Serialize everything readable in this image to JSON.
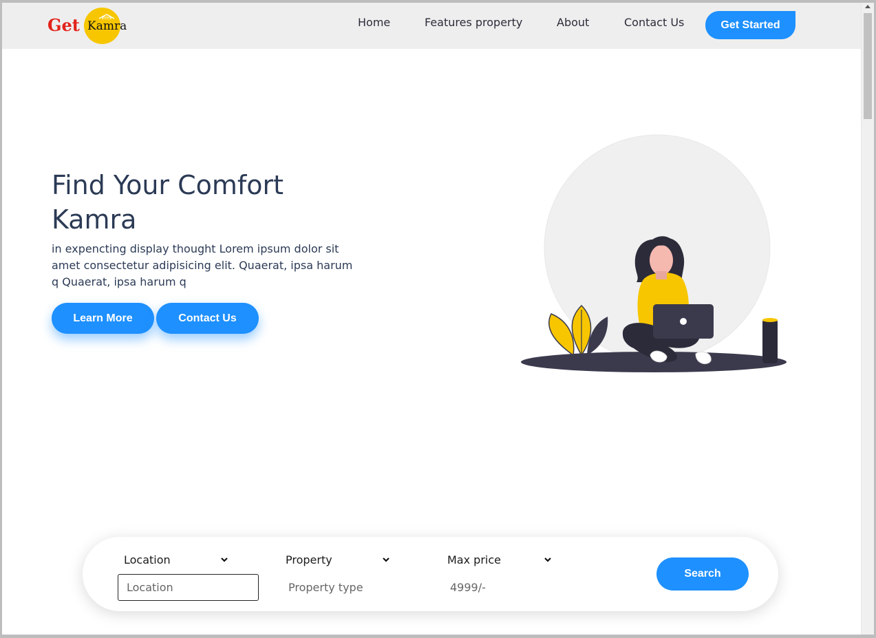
{
  "brand": {
    "logo_get": "Get",
    "logo_kamra": "Kamra"
  },
  "nav": {
    "links": [
      "Home",
      "Features property",
      "About",
      "Contact Us"
    ],
    "cta": "Get Started"
  },
  "hero": {
    "title": "Find Your Comfort Kamra",
    "text": "in expencting display thought Lorem ipsum dolor sit amet consectetur adipisicing elit. Quaerat, ipsa harum q Quaerat, ipsa harum q",
    "learn_more": "Learn More",
    "contact_us": "Contact Us",
    "illustration_icon": "woman-with-laptop-illustration"
  },
  "search": {
    "location_select": "Location",
    "property_select": "Property",
    "price_select": "Max price",
    "location_placeholder": "Location",
    "property_placeholder": "Property type",
    "price_placeholder": "4999/-",
    "search_label": "Search"
  },
  "colors": {
    "accent": "#1e90ff",
    "logo_circle": "#f7c600",
    "logo_text_red": "#e2231a",
    "navbar_bg": "#eeeeee",
    "heading": "#2b3a55"
  }
}
